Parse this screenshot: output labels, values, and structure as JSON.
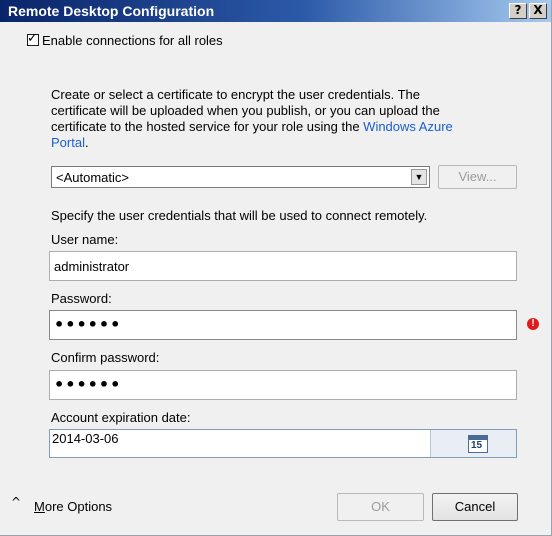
{
  "window": {
    "title": "Remote Desktop Configuration",
    "help_button": "?",
    "close_button": "X"
  },
  "enable_checkbox": {
    "checked": true,
    "label": "Enable connections for all roles"
  },
  "certificate": {
    "description_line1": "Create or select a certificate to encrypt the user credentials.  The",
    "description_line2": "certificate will be uploaded when you publish, or you can upload the",
    "description_line3_prefix": "certificate to the hosted service for your role using the ",
    "description_link_part1": "Windows Azure",
    "description_link_part2": "Portal",
    "description_suffix": ".",
    "select_value": "<Automatic>",
    "view_button": "View..."
  },
  "credentials": {
    "instruction": "Specify the user credentials that will be used to connect remotely.",
    "username_label": "User name:",
    "username_value": "administrator",
    "password_label": "Password:",
    "password_value": "••••••",
    "confirm_label": "Confirm password:",
    "confirm_value": "••••••",
    "expiration_label": "Account expiration date:",
    "expiration_value": "2014-03-06",
    "calendar_day": "15"
  },
  "footer": {
    "more_options_first": "M",
    "more_options_rest": "ore Options",
    "ok_button": "OK",
    "cancel_button": "Cancel"
  },
  "colors": {
    "title_bar": "#0a246a",
    "link": "#1a5fcf",
    "error": "#e11b1b"
  }
}
